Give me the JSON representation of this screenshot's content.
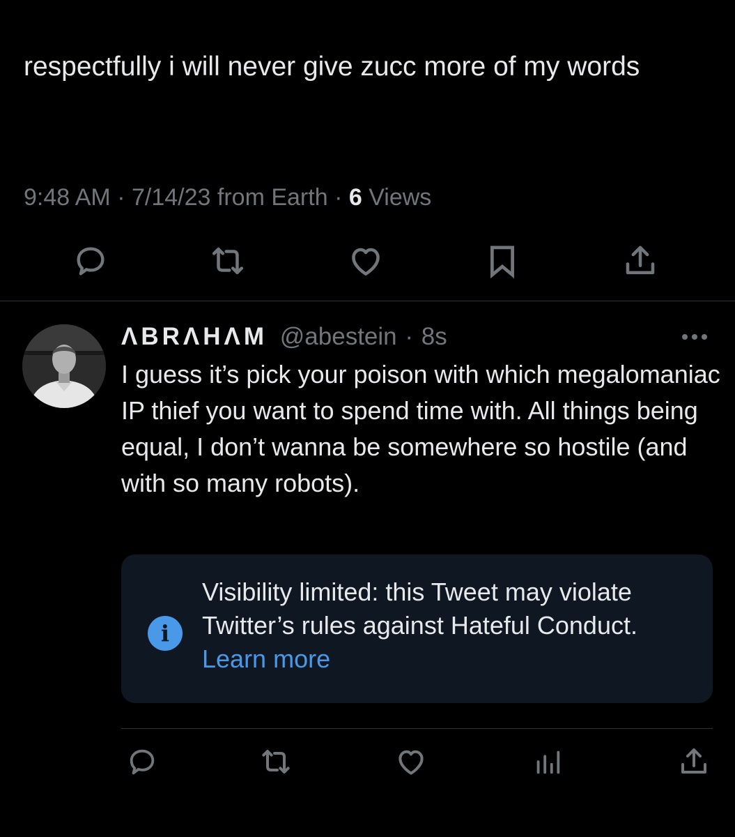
{
  "main_tweet": {
    "text": "respectfully i will never give zucc more of my words",
    "time": "9:48 AM",
    "date": "7/14/23",
    "source": "from Earth",
    "separator": "·",
    "views_count": "6",
    "views_label": "Views",
    "actions": [
      "reply-icon",
      "retweet-icon",
      "like-icon",
      "bookmark-icon",
      "share-icon"
    ]
  },
  "reply": {
    "display_name": "ΛBRΛHΛM",
    "handle": "@abestein",
    "separator": "·",
    "time_ago": "8s",
    "text": "I guess it’s pick your poison with which megalomaniac IP thief you want to spend time with. All things being equal, I don’t wanna be somewhere so hostile (and with so many robots).",
    "notice": {
      "icon": "info-icon",
      "text": "Visibility limited: this Tweet may violate Twitter’s rules against Hateful Conduct.",
      "link": "Learn more"
    },
    "actions": [
      "reply-icon",
      "retweet-icon",
      "like-icon",
      "analytics-icon",
      "share-icon"
    ]
  },
  "colors": {
    "background": "#000000",
    "text_primary": "#e7e9ea",
    "text_secondary": "#71767b",
    "accent": "#4a99e9",
    "notice_bg": "#0f1723",
    "divider": "#2f3336"
  }
}
